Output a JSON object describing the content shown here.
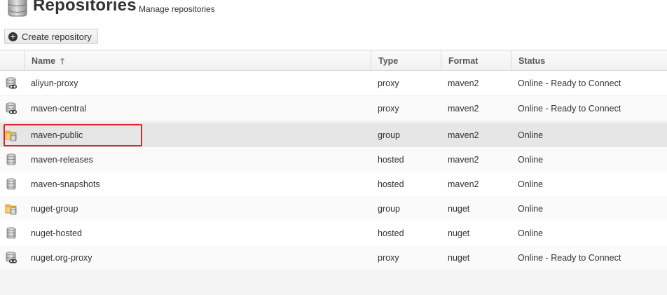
{
  "header": {
    "title": "Repositories",
    "subtitle": "Manage repositories",
    "icon": "database-icon"
  },
  "toolbar": {
    "create_label": "Create repository",
    "create_icon": "plus-circle-icon"
  },
  "table": {
    "columns": [
      "Name",
      "Type",
      "Format",
      "Status"
    ],
    "sort": {
      "column": "Name",
      "direction": "ascending",
      "icon": "arrow-up-icon"
    },
    "selected_row": "maven-public",
    "highlight_color": "#d9262a",
    "rows": [
      {
        "icon": "proxy-repo-icon",
        "name": "aliyun-proxy",
        "type": "proxy",
        "format": "maven2",
        "status": "Online - Ready to Connect"
      },
      {
        "icon": "proxy-repo-icon",
        "name": "maven-central",
        "type": "proxy",
        "format": "maven2",
        "status": "Online - Ready to Connect"
      },
      {
        "icon": "group-repo-icon",
        "name": "maven-public",
        "type": "group",
        "format": "maven2",
        "status": "Online"
      },
      {
        "icon": "hosted-repo-icon",
        "name": "maven-releases",
        "type": "hosted",
        "format": "maven2",
        "status": "Online"
      },
      {
        "icon": "hosted-repo-icon",
        "name": "maven-snapshots",
        "type": "hosted",
        "format": "maven2",
        "status": "Online"
      },
      {
        "icon": "group-repo-icon",
        "name": "nuget-group",
        "type": "group",
        "format": "nuget",
        "status": "Online"
      },
      {
        "icon": "hosted-repo-icon",
        "name": "nuget-hosted",
        "type": "hosted",
        "format": "nuget",
        "status": "Online"
      },
      {
        "icon": "proxy-repo-icon",
        "name": "nuget.org-proxy",
        "type": "proxy",
        "format": "nuget",
        "status": "Online - Ready to Connect"
      }
    ]
  }
}
